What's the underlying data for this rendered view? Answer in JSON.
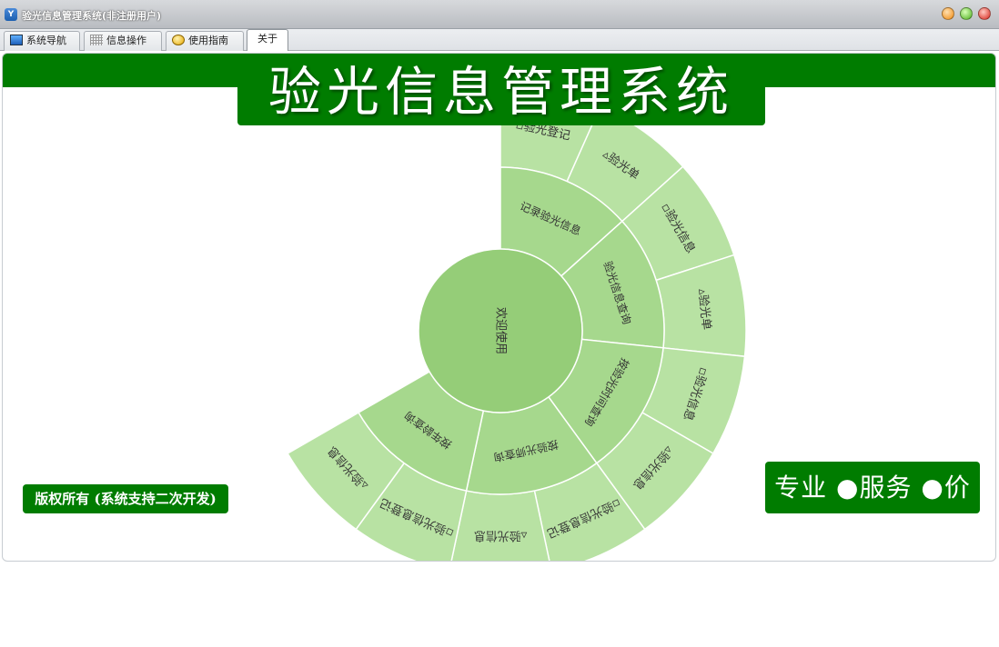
{
  "window": {
    "title": "验光信息管理系统(非注册用户)",
    "app_icon": "Y",
    "controls": [
      "minimize",
      "maximize",
      "close"
    ]
  },
  "tabs": [
    {
      "label": "系统导航",
      "icon": "monitor-icon"
    },
    {
      "label": "信息操作",
      "icon": "grid-icon"
    },
    {
      "label": "使用指南",
      "icon": "help-icon"
    },
    {
      "label": "关于",
      "active": true
    }
  ],
  "banner": {
    "title": "验光信息管理系统"
  },
  "footer": {
    "copyright": "版权所有 (系统支持二次开发)",
    "slogan": "专业 ●服务 ●价值"
  },
  "colors": {
    "brand_green": "#007c00",
    "center": "#95cd78",
    "ring1": "#a6d88d",
    "ring2": "#b8e2a3"
  },
  "sunburst": {
    "center": "欢迎使用",
    "ring1": [
      "记录验光信息",
      "验光信息查询",
      "按验光时间查询",
      "按验光师查询",
      "按年龄查询"
    ],
    "ring2": [
      "▫验光登记",
      "▵验光单",
      "▫验光信息",
      "▵验光单",
      "▫验光信息",
      "▵验光信息",
      "▫验光信息登记",
      "▵验光信息",
      "▫验光信息登记",
      "▵验光信息"
    ]
  }
}
